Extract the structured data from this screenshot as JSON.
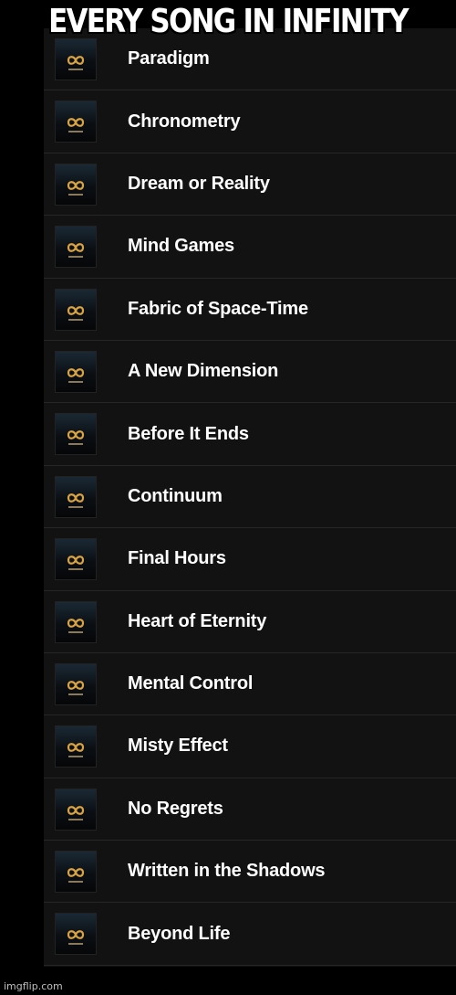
{
  "caption": "EVERY SONG IN INFINITY",
  "album_art_icon": "infinity-icon",
  "tracks": [
    {
      "title": "Paradigm"
    },
    {
      "title": "Chronometry"
    },
    {
      "title": "Dream or Reality"
    },
    {
      "title": "Mind Games"
    },
    {
      "title": "Fabric of Space-Time"
    },
    {
      "title": "A New Dimension"
    },
    {
      "title": "Before It Ends"
    },
    {
      "title": "Continuum"
    },
    {
      "title": "Final Hours"
    },
    {
      "title": "Heart of Eternity"
    },
    {
      "title": "Mental Control"
    },
    {
      "title": "Misty Effect"
    },
    {
      "title": "No Regrets"
    },
    {
      "title": "Written in the Shadows"
    },
    {
      "title": "Beyond Life"
    }
  ],
  "watermark": "imgflip.com"
}
